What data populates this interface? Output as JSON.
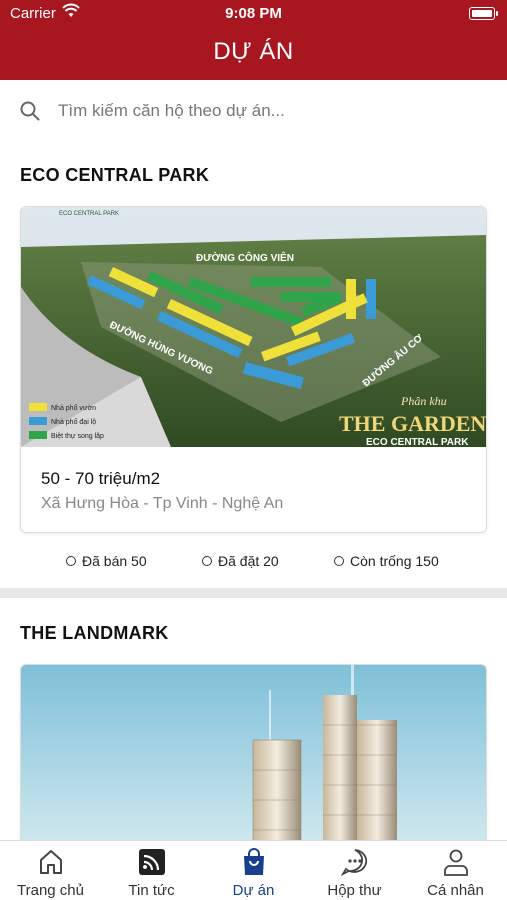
{
  "status_bar": {
    "carrier": "Carrier",
    "time": "9:08 PM"
  },
  "header": {
    "title": "DỰ ÁN"
  },
  "search": {
    "placeholder": "Tìm kiếm căn hộ theo dự án..."
  },
  "projects": [
    {
      "name": "ECO CENTRAL PARK",
      "image_texts": {
        "logo": "ECO CENTRAL PARK",
        "road_1": "ĐƯỜNG CÔNG VIÊN",
        "road_2": "ĐƯỜNG HÙNG VƯƠNG",
        "road_3": "ĐƯỜNG ÂU CƠ",
        "script": "Phân khu",
        "headline": "THE GARDEN",
        "subline": "ECO CENTRAL PARK",
        "legend": [
          "Nhà phố vườn",
          "Nhà phố đại lộ",
          "Biệt thự song lập"
        ]
      },
      "price": "50 - 70 triệu/m2",
      "address": "Xã Hưng Hòa - Tp Vinh - Nghệ An",
      "stats": {
        "sold": "Đã bán 50",
        "reserved": "Đã đặt 20",
        "available": "Còn trống 150"
      }
    },
    {
      "name": "THE LANDMARK"
    }
  ],
  "tabbar": [
    {
      "label": "Trang chủ",
      "icon": "home-icon"
    },
    {
      "label": "Tin tức",
      "icon": "news-icon"
    },
    {
      "label": "Dự án",
      "icon": "shopping-bag-icon",
      "active": true
    },
    {
      "label": "Hộp thư",
      "icon": "chat-icon"
    },
    {
      "label": "Cá nhân",
      "icon": "person-icon"
    }
  ],
  "colors": {
    "header": "#a8161f",
    "active_tab": "#1a3f8c",
    "muted_text": "#888888"
  }
}
